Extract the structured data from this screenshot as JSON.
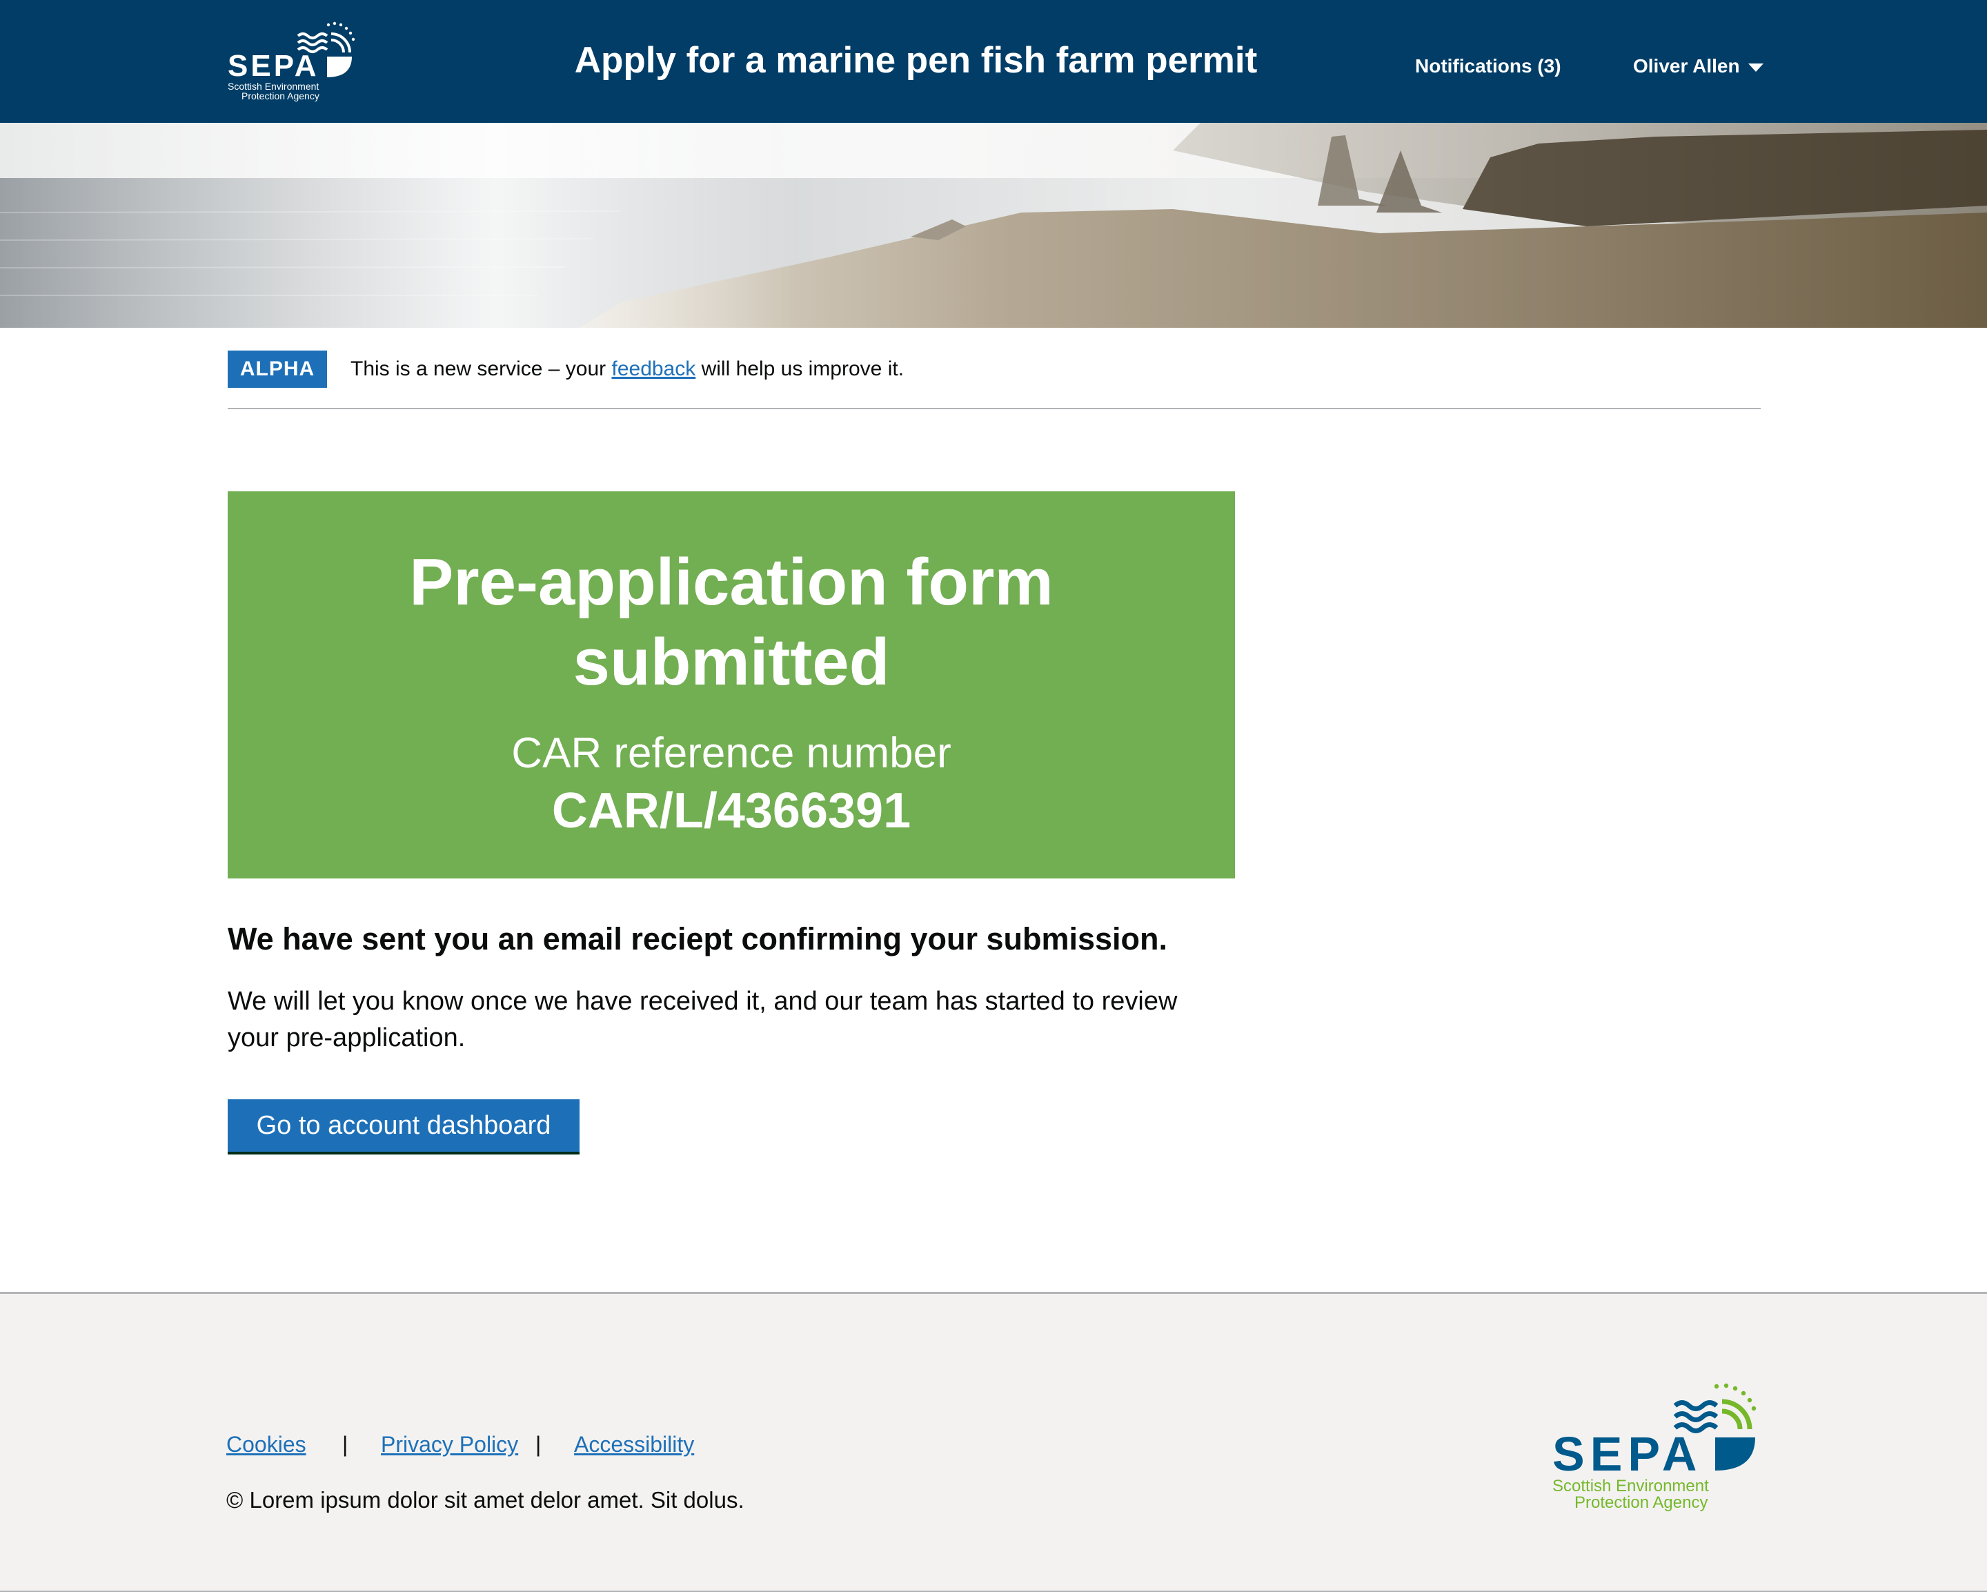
{
  "header": {
    "brand": {
      "logo_text": "SEPA",
      "logo_subtext_line1": "Scottish Environment",
      "logo_subtext_line2": "Protection Agency"
    },
    "service_name": "Apply for a marine pen fish farm permit",
    "notifications": "Notifications (3)",
    "user_name": "Oliver Allen"
  },
  "phase_banner": {
    "tag": "ALPHA",
    "text_before": "This is a new service – your ",
    "link_text": "feedback",
    "text_after": " will help us improve it."
  },
  "panel": {
    "title_line1": "Pre-application form",
    "title_line2": "submitted",
    "reference_label": "CAR reference number",
    "reference_value": "CAR/L/4366391"
  },
  "main": {
    "email_heading": "We have sent you an email reciept confirming your submission.",
    "body_line1": "We will let you know once we have received it, and our team has started to review",
    "body_line2": "your pre-application.",
    "button_label": "Go to account dashboard"
  },
  "footer": {
    "links": [
      "Cookies",
      "Privacy Policy",
      "Accessibility"
    ],
    "separator": "|",
    "copyright": "© Lorem ipsum dolor sit amet delor amet. Sit dolus.",
    "logo": {
      "text": "SEPA",
      "subtext_line1": "Scottish Environment",
      "subtext_line2": "Protection Agency"
    }
  },
  "colors": {
    "header_bg": "#013d66",
    "panel_green": "#72ae52",
    "link_blue": "#1d70b8",
    "footer_bg": "#f3f2f1",
    "logo_green": "#76b82a",
    "logo_blue": "#005a8b"
  }
}
